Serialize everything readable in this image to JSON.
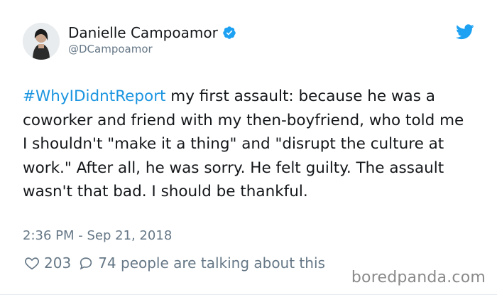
{
  "user": {
    "name": "Danielle Campoamor",
    "handle": "@DCampoamor",
    "verified": true,
    "avatar_icon": "profile-photo"
  },
  "tweet": {
    "hashtag": "#WhyIDidntReport",
    "body": " my first assault: because he was a coworker and friend with my then-boyfriend, who told me I shouldn't \"make it a thing\" and \"disrupt the culture at work.\" After all, he was sorry. He felt guilty. The assault wasn't that bad. I should be thankful.",
    "timestamp": "2:36 PM - Sep 21, 2018"
  },
  "stats": {
    "likes": "203",
    "replies": "74 people are talking about this"
  },
  "watermark": "boredpanda.com",
  "colors": {
    "accent": "#1b95e0",
    "secondary_text": "#657786",
    "primary_text": "#14171a"
  }
}
